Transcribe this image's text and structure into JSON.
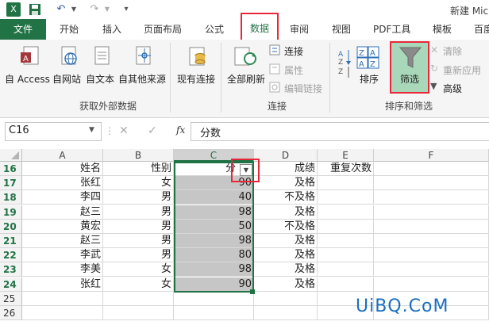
{
  "window": {
    "title": "新建 Mic"
  },
  "quick_access": {
    "excel_icon": "excel-logo-icon",
    "save_icon": "save-icon",
    "undo_icon": "undo-icon",
    "redo_icon": "redo-icon"
  },
  "tabs": [
    "文件",
    "开始",
    "插入",
    "页面布局",
    "公式",
    "数据",
    "审阅",
    "视图",
    "PDF工具",
    "模板",
    "百度"
  ],
  "active_tab": "数据",
  "ribbon": {
    "get_external_data": {
      "label": "获取外部数据",
      "buttons": [
        "自 Access",
        "自网站",
        "自文本",
        "自其他来源"
      ]
    },
    "existing_connections": "现有连接",
    "connections": {
      "label": "连接",
      "refresh_all": "全部刷新",
      "connections": "连接",
      "properties": "属性",
      "edit_links": "编辑链接"
    },
    "sort_filter": {
      "label": "排序和筛选",
      "sort": "排序",
      "filter": "筛选",
      "clear": "清除",
      "reapply": "重新应用",
      "advanced": "高级"
    }
  },
  "formula_bar": {
    "name_box": "C16",
    "fx": "fx",
    "content": "分数"
  },
  "grid": {
    "columns": [
      "A",
      "B",
      "C",
      "D",
      "E",
      "F"
    ],
    "rows": [
      {
        "num": "16",
        "cells": [
          "姓名",
          "性别",
          "分",
          "成绩",
          "重复次数",
          ""
        ]
      },
      {
        "num": "17",
        "cells": [
          "张红",
          "女",
          "90",
          "及格",
          "",
          ""
        ]
      },
      {
        "num": "18",
        "cells": [
          "李四",
          "男",
          "40",
          "不及格",
          "",
          ""
        ]
      },
      {
        "num": "19",
        "cells": [
          "赵三",
          "男",
          "98",
          "及格",
          "",
          ""
        ]
      },
      {
        "num": "20",
        "cells": [
          "黄宏",
          "男",
          "50",
          "不及格",
          "",
          ""
        ]
      },
      {
        "num": "21",
        "cells": [
          "赵三",
          "男",
          "98",
          "及格",
          "",
          ""
        ]
      },
      {
        "num": "22",
        "cells": [
          "李武",
          "男",
          "80",
          "及格",
          "",
          ""
        ]
      },
      {
        "num": "23",
        "cells": [
          "李美",
          "女",
          "98",
          "及格",
          "",
          ""
        ]
      },
      {
        "num": "24",
        "cells": [
          "张红",
          "女",
          "90",
          "及格",
          "",
          ""
        ]
      },
      {
        "num": "25",
        "cells": [
          "",
          "",
          "",
          "",
          "",
          ""
        ]
      },
      {
        "num": "26",
        "cells": [
          "",
          "",
          "",
          "",
          "",
          ""
        ]
      }
    ]
  },
  "watermark": "UiBQ.CoM",
  "colors": {
    "excel_green": "#217346",
    "highlight_red": "#e8283a",
    "selection_gray": "#c6c6c6",
    "filter_active": "#a9d7b9"
  }
}
